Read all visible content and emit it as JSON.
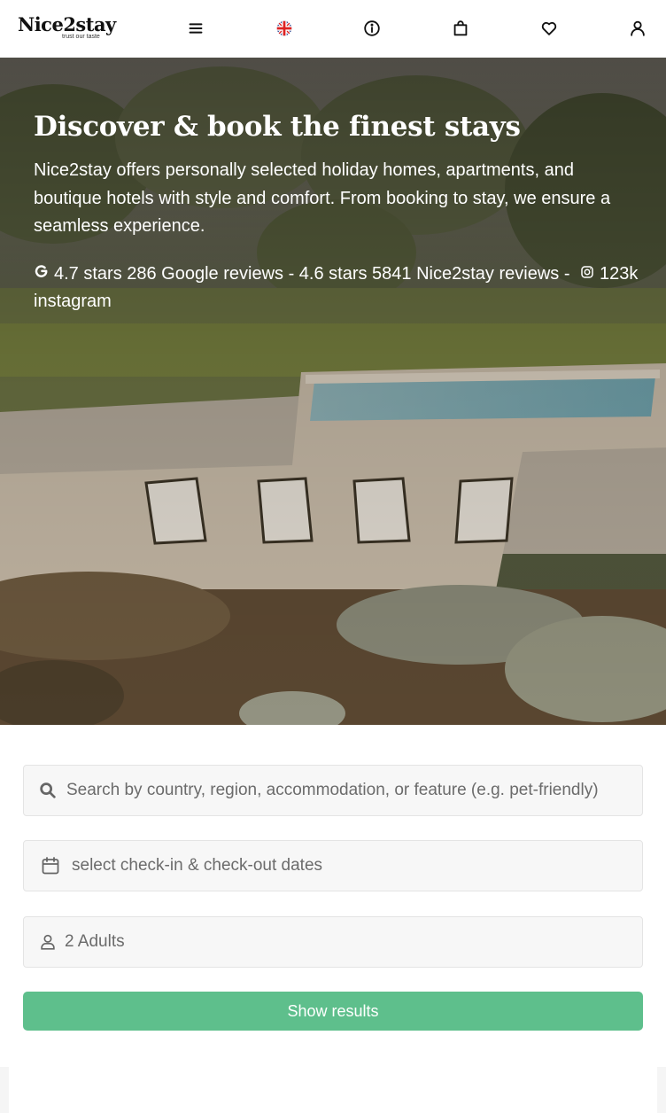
{
  "header": {
    "logo_text": "Nice2stay",
    "logo_tagline": "trust our taste",
    "icons": [
      "menu-icon",
      "uk-flag-icon",
      "info-icon",
      "bag-icon",
      "heart-icon",
      "user-icon"
    ]
  },
  "hero": {
    "title": "Discover & book the finest stays",
    "description": "Nice2stay offers personally selected holiday homes, apartments, and boutique hotels with style and comfort. From booking to stay, we ensure a seamless experience.",
    "reviews_google": "4.7 stars 286 Google reviews - 4.6 stars 5841 Nice2stay reviews -",
    "reviews_instagram": "123k instagram"
  },
  "search": {
    "query_placeholder": "Search by country, region, accommodation, or feature (e.g. pet-friendly)",
    "dates_placeholder": "select check-in & check-out dates",
    "guests_value": "2 Adults",
    "submit_label": "Show results"
  },
  "colors": {
    "accent": "#5ebf8c",
    "header_bg": "#ffffff",
    "field_bg": "#f7f7f7"
  }
}
